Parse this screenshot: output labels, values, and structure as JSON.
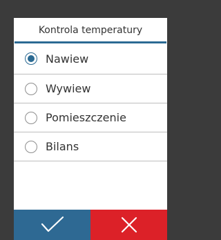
{
  "dialog": {
    "title": "Kontrola temperatury",
    "options": [
      {
        "label": "Nawiew",
        "selected": true
      },
      {
        "label": "Wywiew",
        "selected": false
      },
      {
        "label": "Pomieszczenie",
        "selected": false
      },
      {
        "label": "Bilans",
        "selected": false
      }
    ],
    "confirm_icon": "checkmark-icon",
    "cancel_icon": "close-icon"
  },
  "colors": {
    "accent": "#2b6a93",
    "confirm": "#2e6993",
    "cancel": "#dc2128",
    "frame": "#3b3b3b"
  }
}
